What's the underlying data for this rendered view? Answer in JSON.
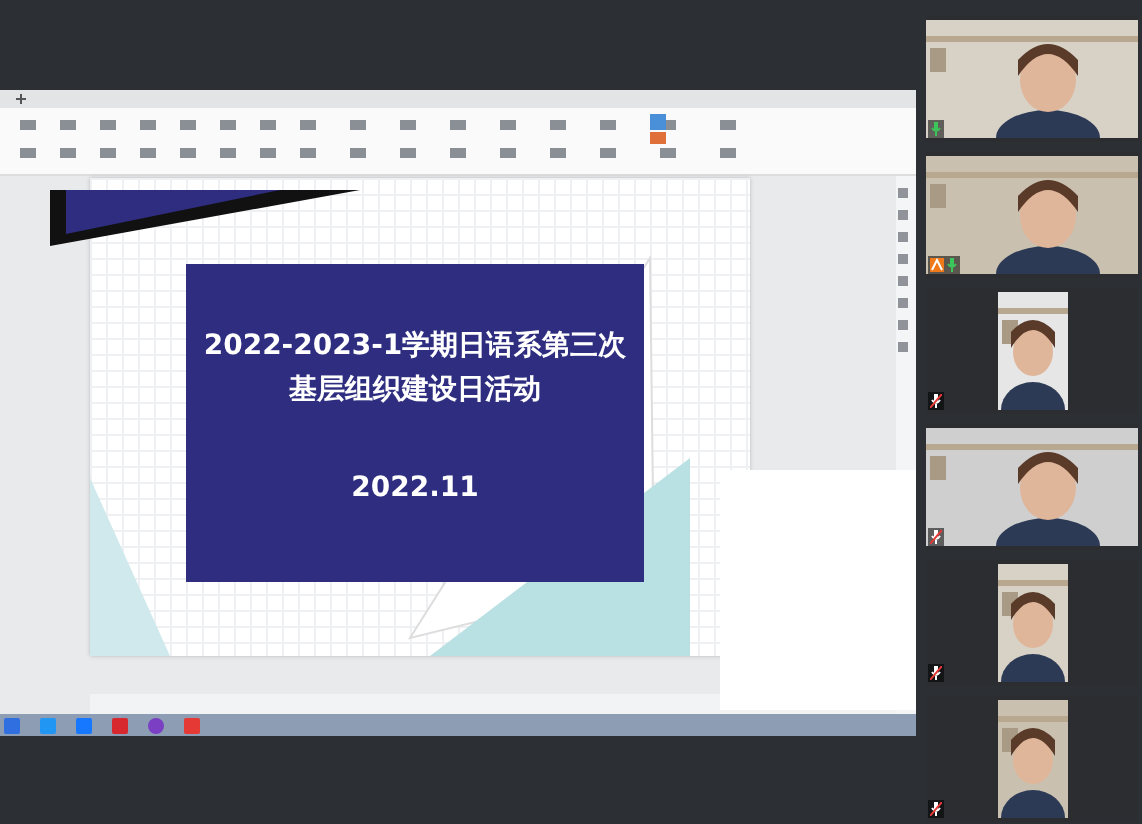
{
  "slide": {
    "title_lines": [
      "2022-2023-1学期日语系第三次",
      "基层组织建设日活动"
    ],
    "date": "2022.11"
  },
  "participants": [
    {
      "kind": "wide",
      "muted": false,
      "host": false
    },
    {
      "kind": "wide",
      "muted": false,
      "host": true
    },
    {
      "kind": "narrow",
      "muted": true,
      "host": false
    },
    {
      "kind": "wide",
      "muted": true,
      "host": false
    },
    {
      "kind": "narrow",
      "muted": true,
      "host": false
    },
    {
      "kind": "narrow",
      "muted": true,
      "host": false
    }
  ]
}
